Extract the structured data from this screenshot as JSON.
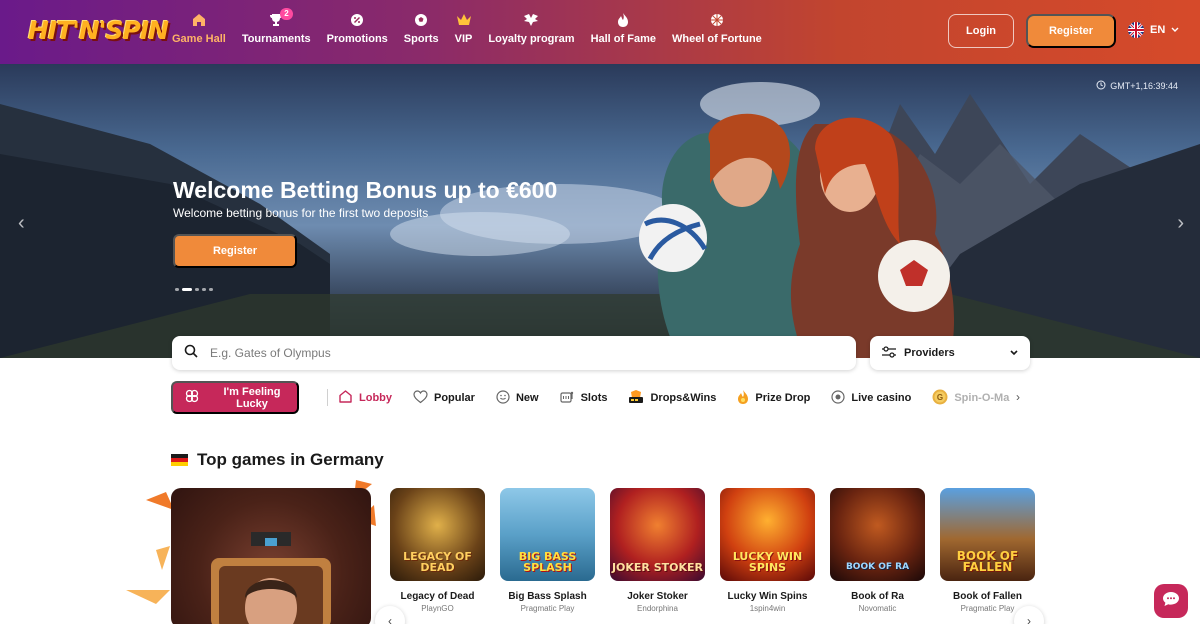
{
  "brand": {
    "logo_text": "HIT'N'SPIN"
  },
  "nav": {
    "items": [
      {
        "label": "Game Hall",
        "icon": "home-icon",
        "active": true
      },
      {
        "label": "Tournaments",
        "icon": "trophy-icon",
        "badge": "2"
      },
      {
        "label": "Promotions",
        "icon": "percent-icon"
      },
      {
        "label": "Sports",
        "icon": "soccer-ball-icon"
      },
      {
        "label": "VIP",
        "icon": "crown-icon"
      },
      {
        "label": "Loyalty program",
        "icon": "wings-icon"
      },
      {
        "label": "Hall of Fame",
        "icon": "flame-icon"
      },
      {
        "label": "Wheel of Fortune",
        "icon": "wheel-icon"
      }
    ]
  },
  "header": {
    "login_label": "Login",
    "register_label": "Register",
    "language": "EN"
  },
  "hero": {
    "clock": "GMT+1,16:39:44",
    "title": "Welcome Betting Bonus up to €600",
    "subtitle": "Welcome betting bonus for the first two deposits",
    "cta_label": "Register",
    "slides_total": 5,
    "active_slide": 2
  },
  "search": {
    "placeholder": "E.g. Gates of Olympus",
    "value": ""
  },
  "providers": {
    "label": "Providers"
  },
  "categories": {
    "lucky_label": "I'm Feeling Lucky",
    "items": [
      {
        "label": "Lobby",
        "icon": "house-icon",
        "active": true
      },
      {
        "label": "Popular",
        "icon": "heart-icon"
      },
      {
        "label": "New",
        "icon": "smile-icon"
      },
      {
        "label": "Slots",
        "icon": "slot-machine-icon"
      },
      {
        "label": "Drops&Wins",
        "icon": "drops-wins-icon"
      },
      {
        "label": "Prize Drop",
        "icon": "prize-drop-icon"
      },
      {
        "label": "Live casino",
        "icon": "live-icon"
      },
      {
        "label": "Spin-O-Ma",
        "icon": "coin-icon",
        "faded": true
      }
    ]
  },
  "top_games": {
    "title": "Top games in Germany",
    "games": [
      {
        "name": "Legacy of Dead",
        "provider": "PlaynGO",
        "art_text": "Legacy of Dead"
      },
      {
        "name": "Big Bass Splash",
        "provider": "Pragmatic Play",
        "art_text": "Big Bass Splash"
      },
      {
        "name": "Joker Stoker",
        "provider": "Endorphina",
        "art_text": "Joker Stoker"
      },
      {
        "name": "Lucky Win Spins",
        "provider": "1spin4win",
        "art_text": "Lucky Win Spins"
      },
      {
        "name": "Book of Ra",
        "provider": "Novomatic",
        "art_text": "Book of Ra"
      },
      {
        "name": "Book of Fallen",
        "provider": "Pragmatic Play",
        "art_text": "Book of Fallen"
      }
    ]
  },
  "colors": {
    "brand_accent": "#f08a3a",
    "active_pink": "#c6285a",
    "nav_active": "#ffb366"
  }
}
